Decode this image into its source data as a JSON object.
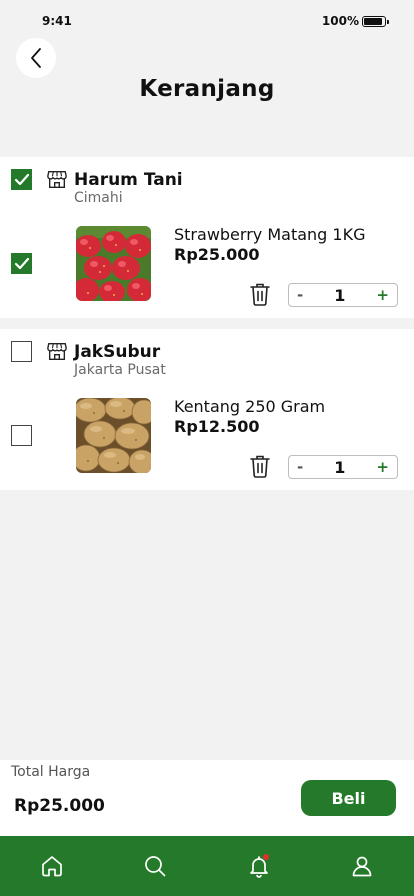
{
  "status_bar": {
    "time": "9:41",
    "battery": "100%"
  },
  "header": {
    "title": "Keranjang"
  },
  "stores": [
    {
      "name": "Harum Tani",
      "city": "Cimahi",
      "checked": true,
      "product": {
        "name": "Strawberry Matang 1KG",
        "price": "Rp25.000",
        "quantity": "1",
        "checked": true,
        "image": "strawberries"
      }
    },
    {
      "name": "JakSubur",
      "city": "Jakarta Pusat",
      "checked": false,
      "product": {
        "name": "Kentang 250 Gram",
        "price": "Rp12.500",
        "quantity": "1",
        "checked": false,
        "image": "potatoes"
      }
    }
  ],
  "stepper": {
    "minus": "-",
    "plus": "+"
  },
  "footer": {
    "total_label": "Total Harga",
    "total_value": "Rp25.000",
    "buy_label": "Beli"
  },
  "bottom_nav": {
    "items": [
      "home-icon",
      "search-icon",
      "bell-icon",
      "user-icon"
    ],
    "notification": true
  },
  "colors": {
    "primary": "#247a2a",
    "background": "#f2f2f2",
    "card": "#ffffff",
    "notification": "#e0302a"
  }
}
